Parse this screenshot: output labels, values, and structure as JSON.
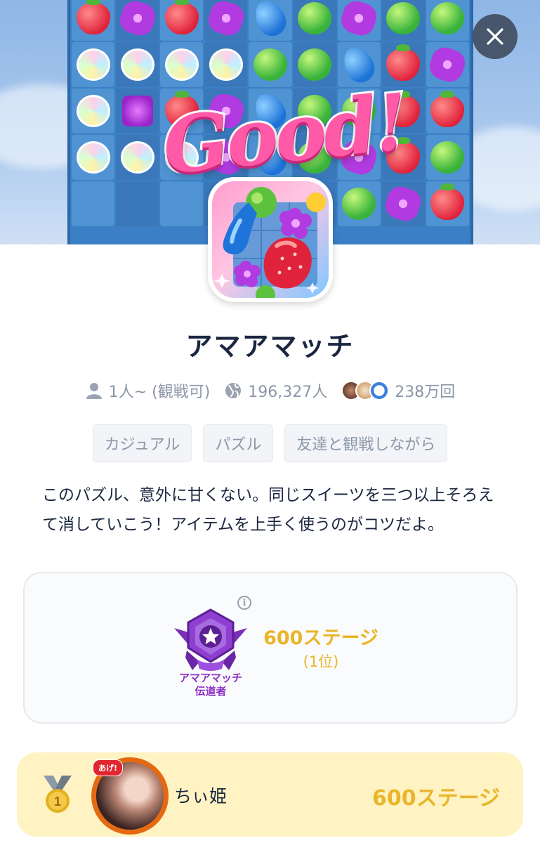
{
  "hero": {
    "banner_text": "Good!",
    "close_icon": "close-icon",
    "board_pieces": [
      "straw",
      "flower",
      "straw",
      "flower",
      "bean",
      "lime",
      "flower",
      "lime",
      "lime",
      "swirl",
      "swirl",
      "swirl",
      "swirl",
      "lime",
      "lime",
      "bean",
      "straw",
      "flower",
      "swirl",
      "wrap",
      "straw",
      "flower",
      "bean",
      "lime",
      "lime",
      "straw",
      "straw",
      "swirl",
      "swirl",
      "swirl",
      "flower",
      "bean",
      "lime",
      "flower",
      "straw",
      "lime",
      "",
      "",
      "",
      "",
      "",
      "",
      "lime",
      "flower",
      "straw"
    ]
  },
  "app": {
    "title": "アマアマッチ",
    "icon": "candy-app-icon"
  },
  "meta": {
    "players": "1人~ (観戦可)",
    "players_icon": "person-icon",
    "users": "196,327人",
    "users_icon": "globe-icon",
    "plays": "238万回"
  },
  "tags": [
    "カジュアル",
    "パズル",
    "友達と観戦しながら"
  ],
  "description": "このパズル、意外に甘くない。同じスイーツを三つ以上そろえて消していこう！アイテムを上手く使うのがコツだよ。",
  "achievement": {
    "badge_label": "アマアマッチ\n伝道者",
    "badge_icon": "purple-star-shield-icon",
    "stage": "600ステージ",
    "rank": "(1位)",
    "info_icon": "info-icon"
  },
  "leaderboard": [
    {
      "rank_icon": "gold-medal-1-icon",
      "rank_number": "1",
      "avatar_badge": "あげ!",
      "name": "ちぃ姫",
      "score": "600ステージ"
    }
  ],
  "colors": {
    "accent_gold": "#e9b52a",
    "badge_purple": "#8d2ec8",
    "leader_row_bg": "#fff3c4",
    "title_navy": "#1b2740"
  }
}
